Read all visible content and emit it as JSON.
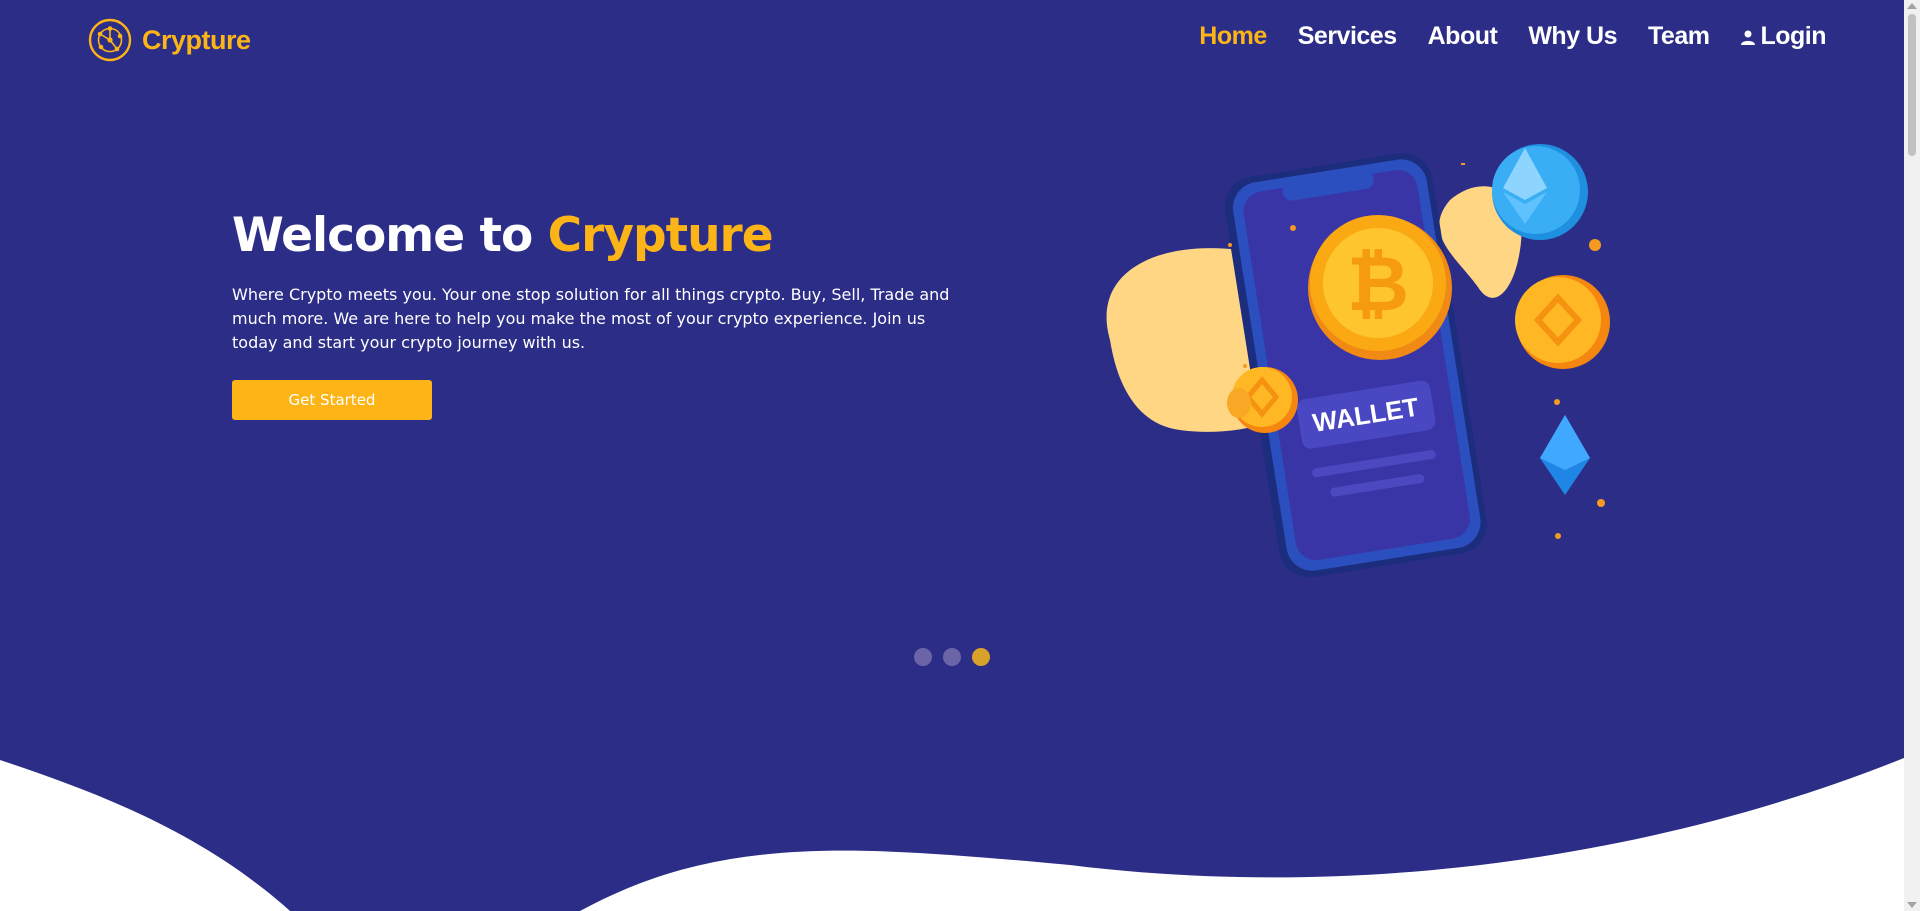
{
  "brand": {
    "name": "Crypture",
    "icon": "crypto-network-icon",
    "color": "#fdb417"
  },
  "nav": {
    "items": [
      {
        "label": "Home",
        "active": true
      },
      {
        "label": "Services"
      },
      {
        "label": "About"
      },
      {
        "label": "Why Us"
      },
      {
        "label": "Team"
      }
    ],
    "login": {
      "label": "Login",
      "icon": "user-icon"
    }
  },
  "hero": {
    "title_prefix": "Welcome to",
    "title_accent": "Crypture",
    "description": "Where Crypto meets you. Your one stop solution for all things crypto. Buy, Sell, Trade and much more. We are here to help you make the most of your crypto experience. Join us today and start your crypto journey with us.",
    "cta_label": "Get Started",
    "illustration": {
      "wallet_label": "WALLET"
    }
  },
  "carousel": {
    "slides": 3,
    "active_index": 2
  },
  "colors": {
    "primary": "#2c2d87",
    "accent": "#fdb417",
    "text": "#ffffff"
  }
}
